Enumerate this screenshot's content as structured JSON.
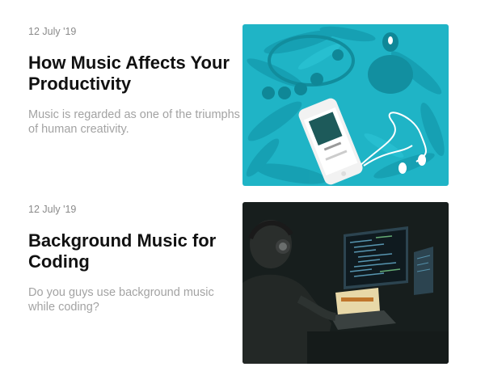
{
  "posts": [
    {
      "date": "12 July '19",
      "title": "How Music Affects Your Productivity",
      "excerpt": "Music is regarded as one of the triumphs of human creativity.",
      "image_color": "#1fb4c6"
    },
    {
      "date": "12 July '19",
      "title": "Background Music for Coding",
      "excerpt": "Do you guys use background music while coding?",
      "image_color": "#1c2422"
    }
  ]
}
